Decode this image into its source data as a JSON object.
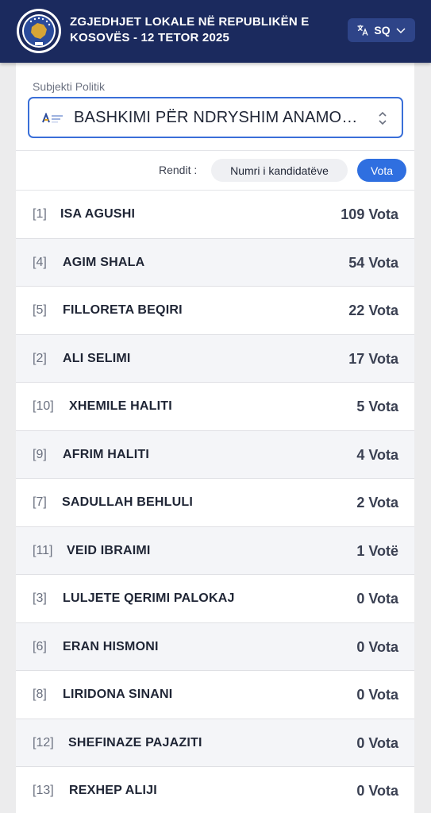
{
  "header": {
    "title": "ZGJEDHJET LOKALE NË REPUBLIKËN E KOSOVËS - 12 TETOR 2025",
    "language": "SQ",
    "colors": {
      "background": "#1b2a5e",
      "button": "#2e4488"
    }
  },
  "filter": {
    "label": "Subjekti Politik",
    "selected": "BASHKIMI PËR NDRYSHIM ANAMORAVA"
  },
  "sort": {
    "label": "Rendit :",
    "options": [
      "Numri i kandidatëve",
      "Vota"
    ],
    "active": "Vota",
    "accent": "#2f6fe0"
  },
  "candidates": [
    {
      "num": "[1]",
      "name": "ISA AGUSHI",
      "votes": "109 Vota"
    },
    {
      "num": "[4]",
      "name": "AGIM SHALA",
      "votes": "54 Vota"
    },
    {
      "num": "[5]",
      "name": "FILLORETA BEQIRI",
      "votes": "22 Vota"
    },
    {
      "num": "[2]",
      "name": "ALI SELIMI",
      "votes": "17 Vota"
    },
    {
      "num": "[10]",
      "name": "XHEMILE HALITI",
      "votes": "5 Vota"
    },
    {
      "num": "[9]",
      "name": "AFRIM HALITI",
      "votes": "4 Vota"
    },
    {
      "num": "[7]",
      "name": "SADULLAH BEHLULI",
      "votes": "2 Vota"
    },
    {
      "num": "[11]",
      "name": "VEID IBRAIMI",
      "votes": "1 Votë"
    },
    {
      "num": "[3]",
      "name": "LULJETE QERIMI PALOKAJ",
      "votes": "0 Vota"
    },
    {
      "num": "[6]",
      "name": "ERAN HISMONI",
      "votes": "0 Vota"
    },
    {
      "num": "[8]",
      "name": "LIRIDONA SINANI",
      "votes": "0 Vota"
    },
    {
      "num": "[12]",
      "name": "SHEFINAZE PAJAZITI",
      "votes": "0 Vota"
    },
    {
      "num": "[13]",
      "name": "REXHEP ALIJI",
      "votes": "0 Vota"
    }
  ]
}
